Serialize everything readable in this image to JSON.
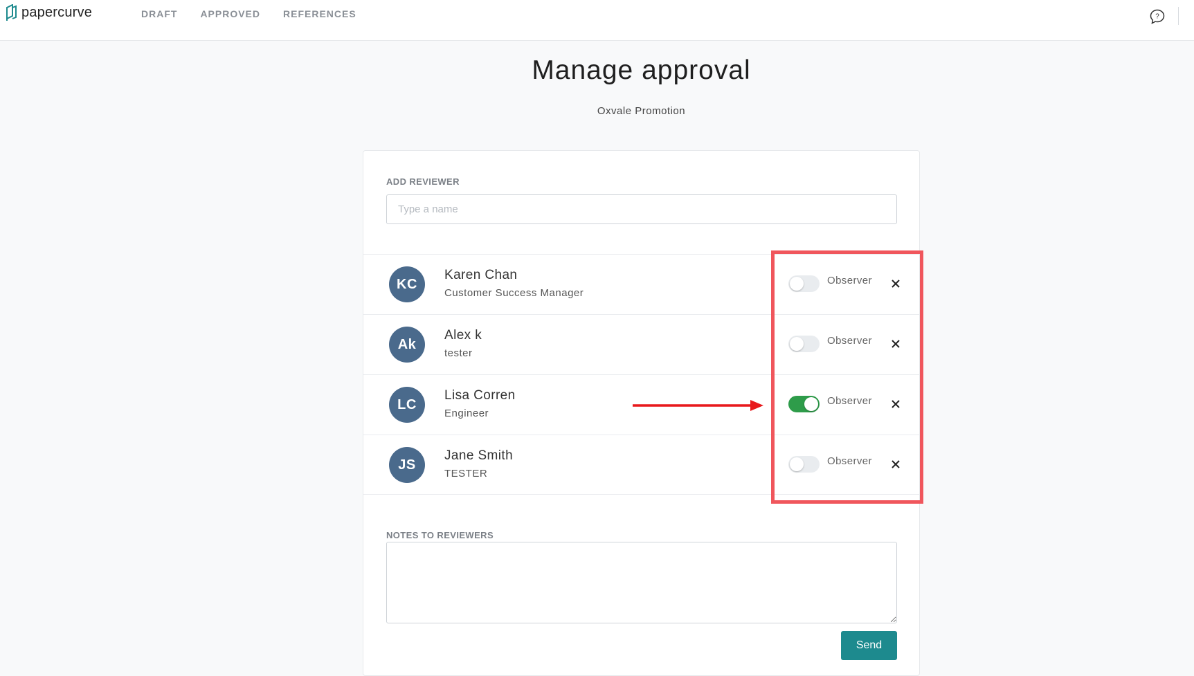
{
  "brand": {
    "name": "papercurve",
    "accent": "#1d8a8e"
  },
  "nav": {
    "items": [
      "DRAFT",
      "APPROVED",
      "REFERENCES"
    ]
  },
  "header": {
    "help_icon": "help-chat-icon"
  },
  "page": {
    "title": "Manage approval",
    "document_name": "Oxvale Promotion"
  },
  "add_reviewer": {
    "label": "ADD REVIEWER",
    "placeholder": "Type a name",
    "value": ""
  },
  "reviewers": [
    {
      "initials": "KC",
      "name": "Karen Chan",
      "role": "Customer Success Manager",
      "observer_label": "Observer",
      "observer": false
    },
    {
      "initials": "Ak",
      "name": "Alex k",
      "role": "tester",
      "observer_label": "Observer",
      "observer": false
    },
    {
      "initials": "LC",
      "name": "Lisa Corren",
      "role": "Engineer",
      "observer_label": "Observer",
      "observer": true
    },
    {
      "initials": "JS",
      "name": "Jane Smith",
      "role": "TESTER",
      "observer_label": "Observer",
      "observer": false
    }
  ],
  "notes": {
    "label": "NOTES TO REVIEWERS",
    "value": ""
  },
  "actions": {
    "send_label": "Send"
  },
  "colors": {
    "toggle_on": "#2e9c4a",
    "avatar": "#4a6a8c",
    "highlight": "#f0565c",
    "arrow": "#e8191c"
  }
}
